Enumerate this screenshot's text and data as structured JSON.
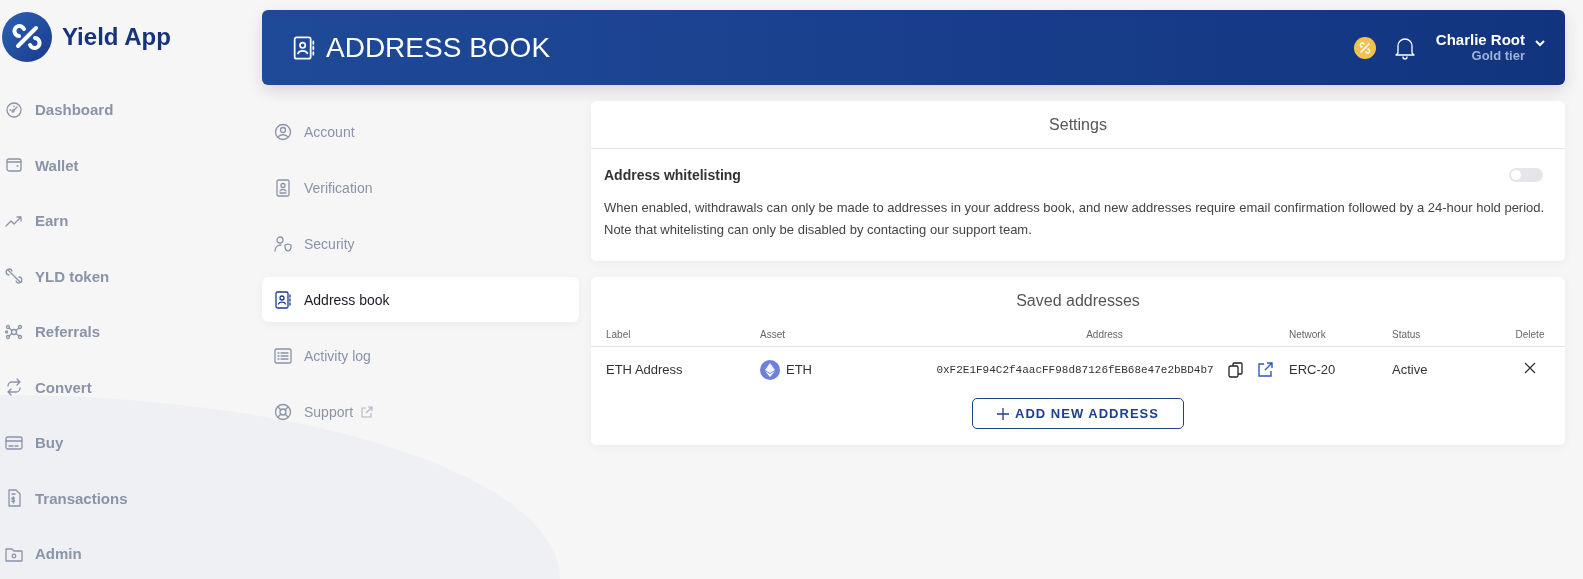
{
  "brand": {
    "name": "Yield App"
  },
  "sidebar": {
    "items": [
      {
        "label": "Dashboard",
        "selected": false
      },
      {
        "label": "Wallet",
        "selected": false
      },
      {
        "label": "Earn",
        "selected": false
      },
      {
        "label": "YLD token",
        "selected": false
      },
      {
        "label": "Referrals",
        "selected": false
      },
      {
        "label": "Convert",
        "selected": false
      },
      {
        "label": "Buy",
        "selected": false
      },
      {
        "label": "Transactions",
        "selected": false
      },
      {
        "label": "Admin",
        "selected": false
      }
    ]
  },
  "header": {
    "title": "ADDRESS BOOK",
    "user": {
      "name": "Charlie Root",
      "tier": "Gold tier"
    }
  },
  "settings_nav": {
    "items": [
      {
        "label": "Account",
        "selected": false,
        "external": false
      },
      {
        "label": "Verification",
        "selected": false,
        "external": false
      },
      {
        "label": "Security",
        "selected": false,
        "external": false
      },
      {
        "label": "Address book",
        "selected": true,
        "external": false
      },
      {
        "label": "Activity log",
        "selected": false,
        "external": false
      },
      {
        "label": "Support",
        "selected": false,
        "external": true
      }
    ]
  },
  "settings": {
    "title": "Settings",
    "whitelisting": {
      "label": "Address whitelisting",
      "on": false,
      "description": "When enabled, withdrawals can only be made to addresses in your address book, and new addresses require email confirmation followed by a 24-hour hold period. Note that whitelisting can only be disabled by contacting our support team."
    }
  },
  "saved_addresses": {
    "title": "Saved addresses",
    "columns": [
      "Label",
      "Asset",
      "Address",
      "Network",
      "Status",
      "Delete"
    ],
    "rows": [
      {
        "label": "ETH Address",
        "asset": "ETH",
        "address": "0xF2E1F94C2f4aacFF98d87126fEB68e47e2bBD4b7",
        "network": "ERC-20",
        "status": "Active"
      }
    ],
    "add_button": "ADD NEW ADDRESS"
  }
}
